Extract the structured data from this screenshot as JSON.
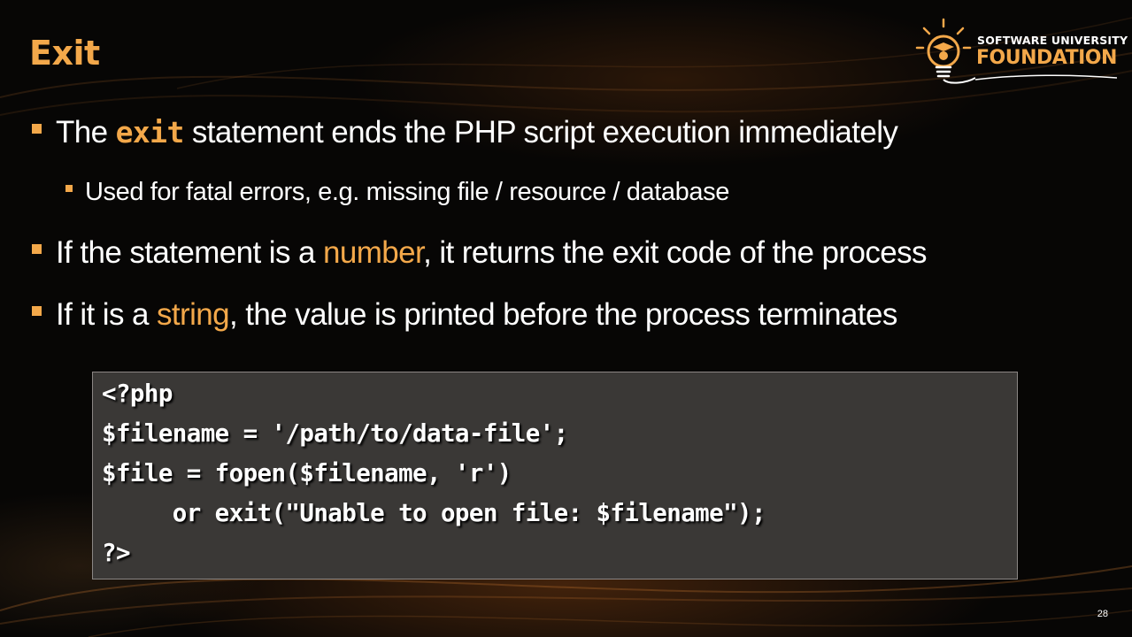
{
  "slide": {
    "title": "Exit",
    "page_number": "28"
  },
  "logo": {
    "line1": "SOFTWARE UNIVERSITY",
    "line2": "FOUNDATION",
    "icon": "lightbulb-graduate-icon"
  },
  "bullets": {
    "b1": {
      "pre": "The ",
      "code": "exit",
      "post": " statement ends the PHP script execution immediately"
    },
    "b1_sub": "Used for fatal errors, e.g. missing file / resource / database",
    "b2": {
      "pre": "If the statement is a ",
      "hl": "number",
      "post": ", it returns the exit code of the process"
    },
    "b3": {
      "pre": "If it is a ",
      "hl": "string",
      "post": ", the value is printed before the process terminates"
    }
  },
  "code": {
    "lines": [
      "<?php",
      "$filename = '/path/to/data-file';",
      "$file = fopen($filename, 'r')",
      "     or exit(\"Unable to open file: $filename\");",
      "?>"
    ]
  },
  "colors": {
    "accent": "#f3a84a",
    "background": "#070605",
    "code_background": "#3a3836"
  }
}
